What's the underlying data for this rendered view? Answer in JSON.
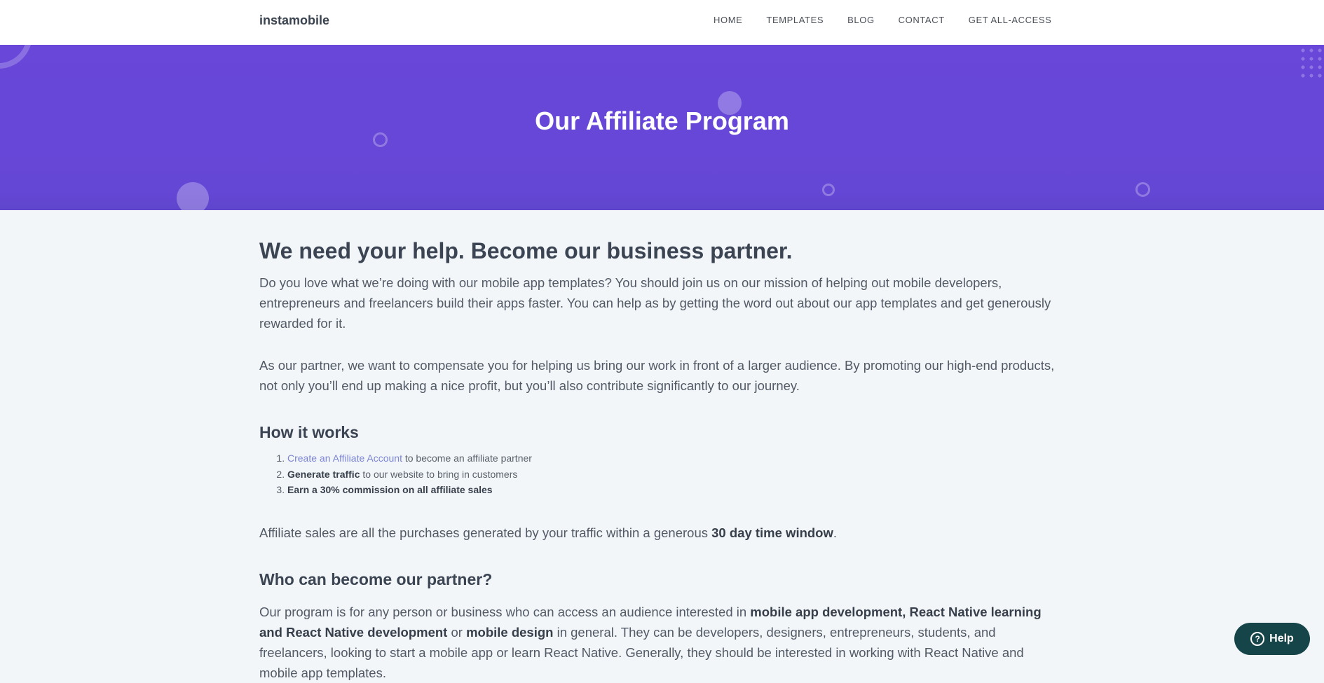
{
  "header": {
    "brand": "instamobile",
    "nav": [
      "HOME",
      "TEMPLATES",
      "BLOG",
      "CONTACT",
      "GET ALL-ACCESS"
    ]
  },
  "hero": {
    "title": "Our Affiliate Program"
  },
  "intro": {
    "heading": "We need your help. Become our business partner.",
    "p1": "Do you love what we’re doing with our mobile app templates? You should join us on our mission of helping out mobile developers, entrepreneurs and freelancers build their apps faster. You can help as by getting the word out about our app templates and get generously rewarded for it.",
    "p2": "As our partner, we want to compensate you for helping us bring our work in front of a larger audience. By promoting our high-end products, not only you’ll end up making a nice profit, but you’ll also contribute significantly to our journey."
  },
  "how_it_works": {
    "heading": "How it works",
    "step1_link": "Create an Affiliate Account",
    "step1_rest": " to become an affiliate partner",
    "step2_bold": "Generate traffic",
    "step2_rest": " to our website to bring in customers",
    "step3_bold": "Earn a 30% commission on all affiliate sales"
  },
  "affiliate_sales": {
    "text": "Affiliate sales are all the purchases generated by your traffic within a generous ",
    "bold": "30 day time window",
    "end": "."
  },
  "who": {
    "heading": "Who can become our partner?",
    "t1": "Our program is for any person or business who can access an audience interested in ",
    "b1": "mobile app development, React Native learning and React Native development",
    "t2": " or ",
    "b2": "mobile design",
    "t3": " in general. They can be developers, designers, entrepreneurs, students, and freelancers, looking to start a mobile app or learn React Native. Generally, they should be interested in working with React Native and mobile app templates."
  },
  "help_button": {
    "label": "Help",
    "icon": "question-icon"
  },
  "colors": {
    "hero": "#6847d9",
    "help": "#154549",
    "link": "#7b85d4"
  }
}
